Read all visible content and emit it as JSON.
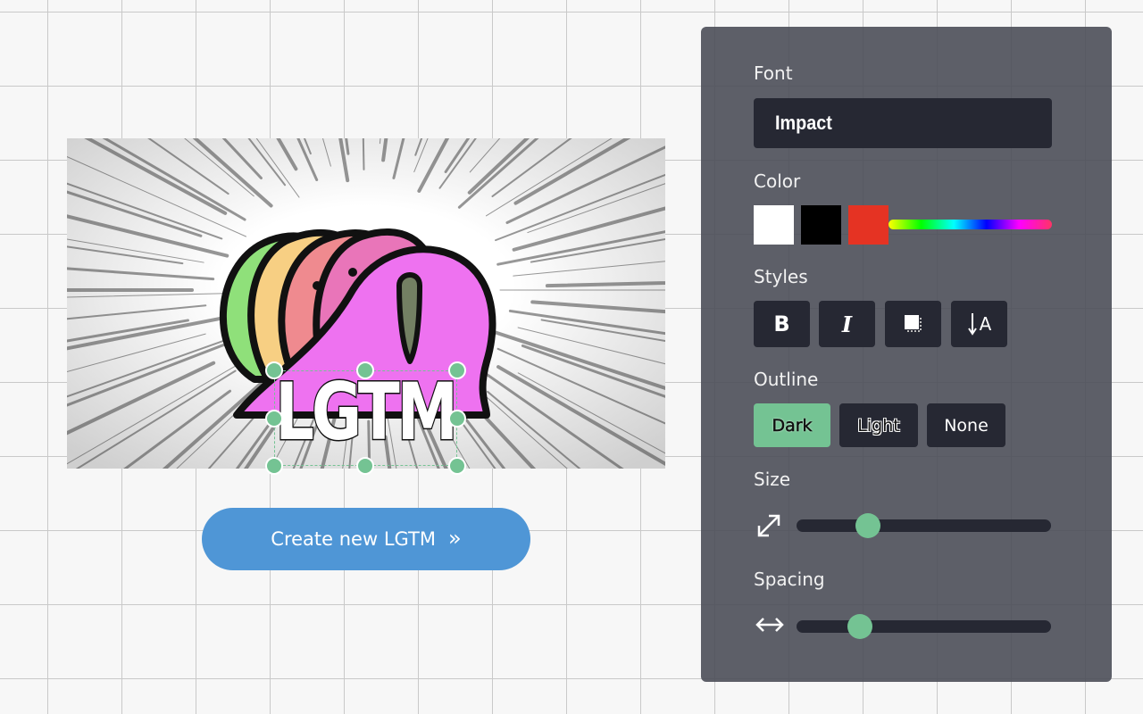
{
  "image": {
    "caption_text": "LGTM"
  },
  "actions": {
    "create_label": "Create new LGTM",
    "create_chevron": "»"
  },
  "panel": {
    "font": {
      "label": "Font",
      "value": "Impact"
    },
    "color": {
      "label": "Color",
      "swatches": [
        "#ffffff",
        "#000000",
        "#e53323"
      ],
      "selected": "#e53323"
    },
    "styles": {
      "label": "Styles",
      "bold_label": "B",
      "italic_label": "I",
      "vertical_label": "A"
    },
    "outline": {
      "label": "Outline",
      "options": [
        "Dark",
        "Light",
        "None"
      ],
      "selected": "Dark"
    },
    "size": {
      "label": "Size",
      "value": 0.28
    },
    "spacing": {
      "label": "Spacing",
      "value": 0.25
    }
  },
  "colors": {
    "accent_green": "#74c393",
    "button_blue": "#4f96d6",
    "panel_bg": "#484a54",
    "control_bg": "#262833"
  }
}
